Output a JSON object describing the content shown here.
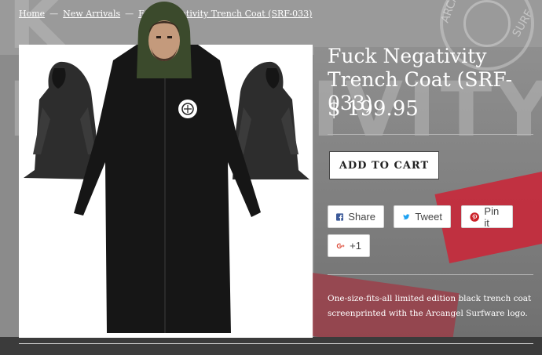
{
  "breadcrumb": {
    "home": "Home",
    "category": "New Arrivals",
    "current": "Fuck Negativity Trench Coat (SRF-033)",
    "separator": "—"
  },
  "product": {
    "title": "Fuck Negativity Trench Coat (SRF-033)",
    "price": "$ 199.95",
    "add_to_cart_label": "ADD TO CART",
    "description": "One-size-fits-all limited edition black trench coat screenprinted with the Arcangel Surfware logo."
  },
  "share": {
    "facebook_label": "Share",
    "twitter_label": "Tweet",
    "pinterest_label": "Pin it",
    "gplus_label": "+1"
  },
  "background": {
    "banner_text": "K NEGATIVITY",
    "seal_text": "ARCANGEL SURF"
  },
  "colors": {
    "facebook": "#3b5998",
    "twitter": "#1da1f2",
    "pinterest": "#cb2027",
    "gplus": "#dd4b39",
    "accent_red": "#c8283a"
  },
  "icons": [
    "facebook-icon",
    "twitter-icon",
    "pinterest-icon",
    "google-plus-icon"
  ]
}
